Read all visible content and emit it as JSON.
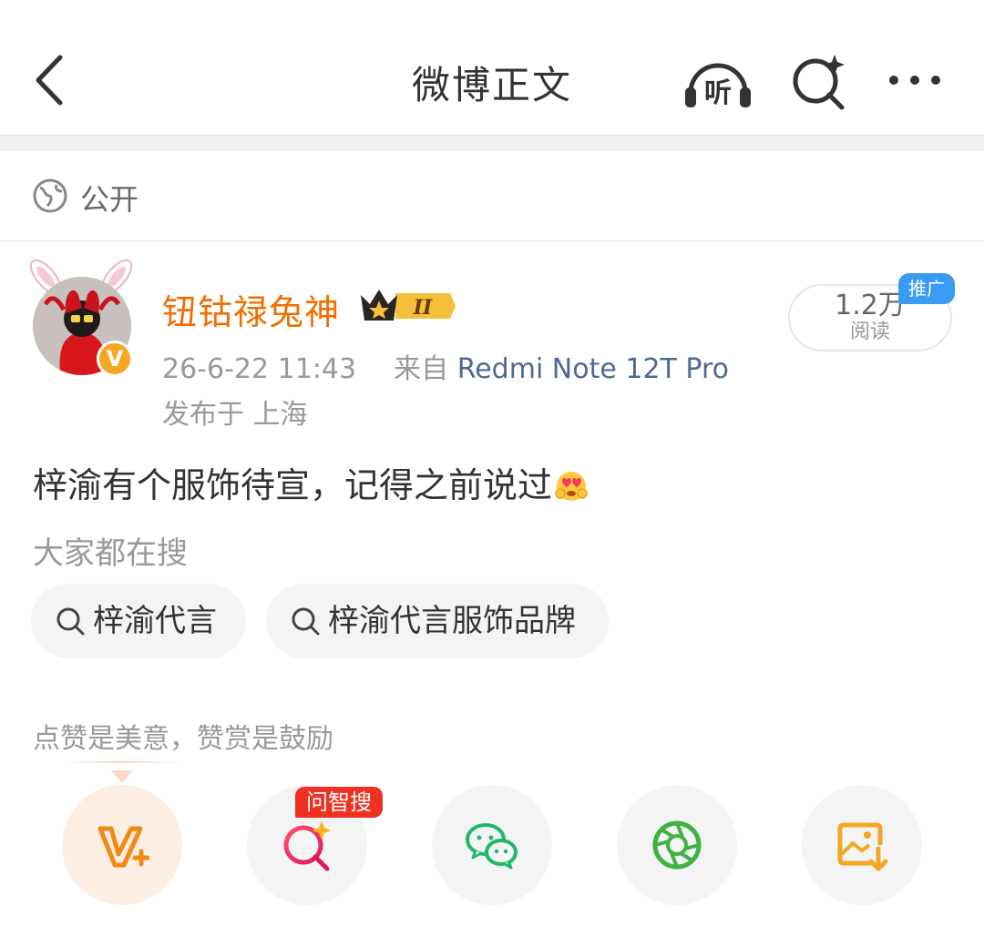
{
  "header": {
    "title": "微博正文",
    "listen_label": "听"
  },
  "post": {
    "visibility": "公开",
    "author": {
      "name": "钮钴禄兔神",
      "badge_level": "II",
      "verified_mark": "V"
    },
    "meta": {
      "time": "26-6-22 11:43",
      "from_label": "来自",
      "device": "Redmi Note 12T Pro",
      "location": "发布于 上海"
    },
    "reads": {
      "count": "1.2万",
      "label": "阅读",
      "ad_tag": "推广"
    },
    "text": "梓渝有个服饰待宣，记得之前说过"
  },
  "search": {
    "label": "大家都在搜",
    "chips": [
      "梓渝代言",
      "梓渝代言服饰品牌"
    ]
  },
  "actions": {
    "praise_text": "点赞是美意，赞赏是鼓励",
    "ask_badge": "问智搜",
    "items": [
      "reward-icon",
      "ai-search-icon",
      "wechat-icon",
      "moments-icon",
      "save-image-icon"
    ]
  },
  "colors": {
    "accent_orange": "#f16e00",
    "link_blue": "#4f6a92",
    "ad_blue": "#3a9bf2",
    "badge_red": "#ee3123"
  }
}
